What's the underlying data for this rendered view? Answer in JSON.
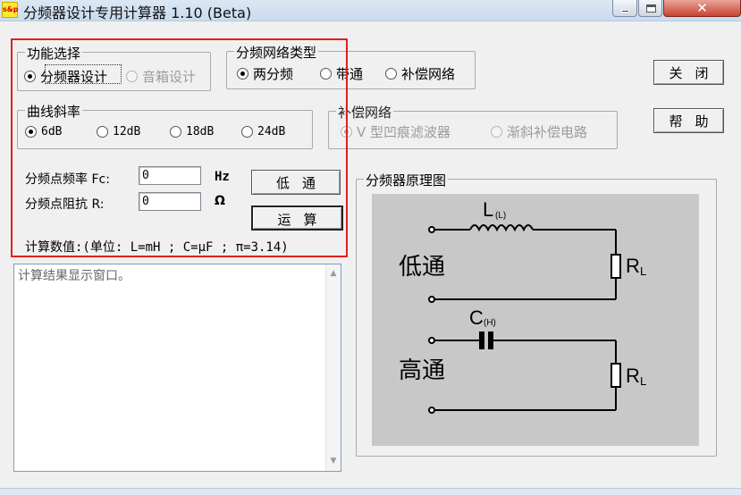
{
  "window": {
    "title": "分频器设计专用计算器 1.10 (Beta)",
    "icon_text": "s&p",
    "controls": [
      "minimize-icon",
      "maximize-icon",
      "close-icon"
    ],
    "close_glyph": "✕"
  },
  "function_select": {
    "title": "功能选择",
    "options": [
      {
        "label": "分频器设计",
        "checked": true,
        "enabled": true
      },
      {
        "label": "音箱设计",
        "checked": false,
        "enabled": false
      }
    ]
  },
  "network_type": {
    "title": "分频网络类型",
    "options": [
      {
        "label": "两分频",
        "checked": true
      },
      {
        "label": "带通",
        "checked": false
      },
      {
        "label": "补偿网络",
        "checked": false
      }
    ]
  },
  "slope": {
    "title": "曲线斜率",
    "options": [
      {
        "label": "6dB",
        "checked": true
      },
      {
        "label": "12dB",
        "checked": false
      },
      {
        "label": "18dB",
        "checked": false
      },
      {
        "label": "24dB",
        "checked": false
      }
    ]
  },
  "compensation": {
    "title": "补偿网络",
    "options": [
      {
        "label": "V 型凹痕滤波器",
        "checked": true,
        "enabled": false
      },
      {
        "label": "渐斜补偿电路",
        "checked": false,
        "enabled": false
      }
    ]
  },
  "inputs": {
    "fc_label": "分频点频率 Fc:",
    "fc_value": "0",
    "fc_unit": "Hz",
    "r_label": "分频点阻抗 R:",
    "r_value": "0",
    "r_unit": "Ω"
  },
  "buttons": {
    "lowpass": "低通",
    "calculate": "运算",
    "close": "关闭",
    "help": "帮助"
  },
  "calc_note": "计算数值:(单位: L=mH ; C=μF ; π=3.14)",
  "result": {
    "text": "计算结果显示窗口。",
    "scroll_up": "▲",
    "scroll_down": "▼"
  },
  "diagram": {
    "title": "分频器原理图",
    "lowpass_label": "低通",
    "highpass_label": "高通",
    "inductor_label": "L",
    "inductor_sub": "(L)",
    "capacitor_label": "C",
    "capacitor_sub": "(H)",
    "load_label": "R",
    "load_sub": "L"
  }
}
